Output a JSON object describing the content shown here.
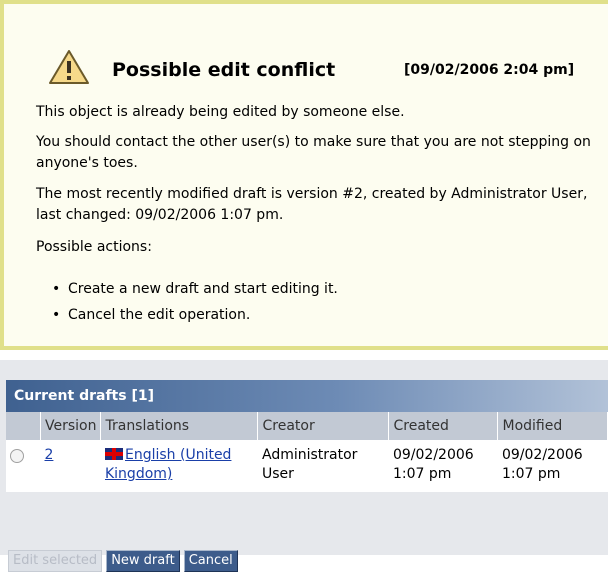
{
  "warning": {
    "title": "Possible edit conflict",
    "timestamp": "[09/02/2006 2:04 pm]",
    "icon": "warning-icon",
    "p1": "This object is already being edited by someone else.",
    "p2": "You should contact the other user(s) to make sure that you are not stepping on anyone's toes.",
    "p3": "The most recently modified draft is version #2, created by Administrator User, last changed: 09/02/2006 1:07 pm.",
    "p4": "Possible actions:",
    "actions": [
      "Create a new draft and start editing it.",
      "Cancel the edit operation."
    ]
  },
  "drafts": {
    "title": "Current drafts [1]",
    "columns": [
      "Version",
      "Translations",
      "Creator",
      "Created",
      "Modified"
    ],
    "rows": [
      {
        "version": "2",
        "translation": "English (United Kingdom)",
        "creator": "Administrator User",
        "created": "09/02/2006 1:07 pm",
        "modified": "09/02/2006 1:07 pm"
      }
    ],
    "buttons": {
      "edit_selected": "Edit selected",
      "new_draft": "New draft",
      "cancel": "Cancel"
    }
  },
  "colors": {
    "border": "#e0e08a",
    "header_blue": "#3f6190",
    "link": "#1a3fa8"
  }
}
